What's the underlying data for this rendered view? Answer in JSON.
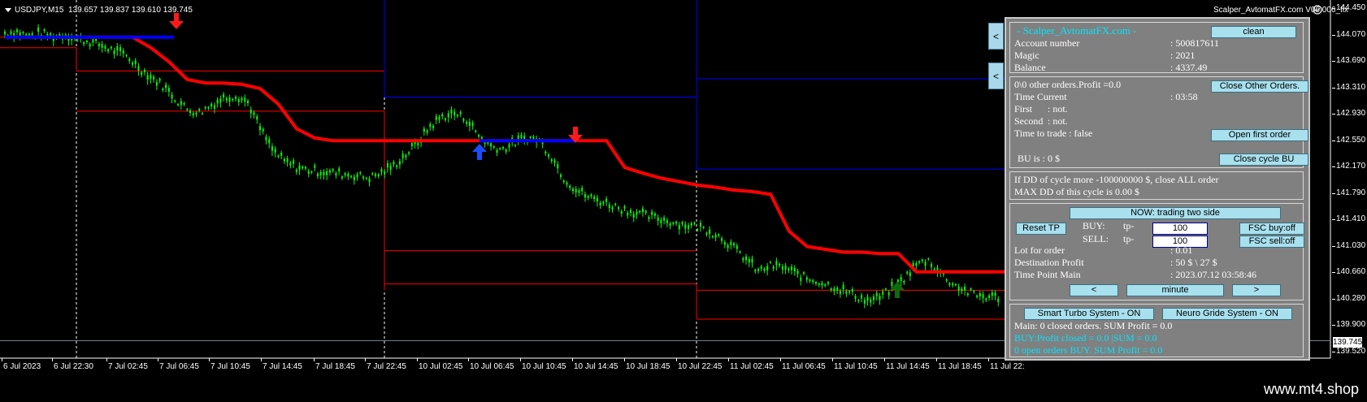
{
  "header": {
    "symbol": "USDJPY,M15",
    "ohlc": "139.657 139.837 139.610 139.745"
  },
  "ea_title": "Scalper_AvtomatFX.com V06.006_fix",
  "price_axis": {
    "labels": [
      "144.450",
      "144.070",
      "143.690",
      "143.310",
      "142.930",
      "142.550",
      "142.170",
      "141.790",
      "141.410",
      "141.030",
      "140.660",
      "140.280",
      "139.900",
      "139.520"
    ],
    "current": "139.745"
  },
  "time_axis": [
    "6 Jul 2023",
    "6 Jul 22:30",
    "7 Jul 02:45",
    "7 Jul 06:45",
    "7 Jul 10:45",
    "7 Jul 14:45",
    "7 Jul 18:45",
    "7 Jul 22:45",
    "10 Jul 02:45",
    "10 Jul 06:45",
    "10 Jul 10:45",
    "10 Jul 14:45",
    "10 Jul 18:45",
    "10 Jul 22:45",
    "11 Jul 02:45",
    "11 Jul 06:45",
    "11 Jul 10:45",
    "11 Jul 14:45",
    "11 Jul 18:45",
    "11 Jul 22:"
  ],
  "chart_data": {
    "type": "candlestick",
    "symbol": "USDJPY",
    "timeframe": "M15",
    "ylim": [
      139.4,
      144.5
    ],
    "price_series": [
      144.1,
      144.12,
      144.06,
      144.1,
      144.05,
      144.08,
      144.02,
      143.98,
      143.92,
      143.85,
      143.78,
      143.62,
      143.48,
      143.36,
      143.18,
      143.02,
      142.98,
      143.08,
      143.18,
      143.22,
      143.12,
      142.75,
      142.45,
      142.28,
      142.2,
      142.16,
      142.14,
      142.12,
      142.1,
      142.08,
      142.05,
      142.12,
      142.22,
      142.38,
      142.55,
      142.78,
      142.92,
      142.96,
      142.88,
      142.65,
      142.5,
      142.46,
      142.55,
      142.62,
      142.58,
      142.35,
      142.05,
      141.88,
      141.78,
      141.72,
      141.66,
      141.6,
      141.55,
      141.5,
      141.46,
      141.42,
      141.38,
      141.36,
      141.3,
      141.2,
      141.05,
      140.9,
      140.72,
      140.8,
      140.78,
      140.7,
      140.62,
      140.58,
      140.52,
      140.45,
      140.38,
      140.3,
      140.35,
      140.48,
      140.62,
      140.82,
      140.88,
      140.7,
      140.55,
      140.45,
      140.38,
      140.36,
      140.35
    ],
    "trailing_stop": [
      144.05,
      144.05,
      144.05,
      144.05,
      144.05,
      144.05,
      144.05,
      144.05,
      143.9,
      143.7,
      143.45,
      143.4,
      143.4,
      143.38,
      143.32,
      143.1,
      142.75,
      142.62,
      142.58,
      142.58,
      142.58,
      142.58,
      142.58,
      142.58,
      142.58,
      142.58,
      142.58,
      142.58,
      142.58,
      142.58,
      142.58,
      142.58,
      142.58,
      142.58,
      142.2,
      142.12,
      142.05,
      142.0,
      141.95,
      141.92,
      141.88,
      141.86,
      141.82,
      141.3,
      141.08,
      141.04,
      141.0,
      141.0,
      140.98,
      140.98,
      140.72,
      140.72,
      140.72,
      140.72,
      140.72,
      140.72
    ],
    "buy_line": {
      "level": 144.05
    },
    "buy_line_2": {
      "level": 142.58
    },
    "signals": [
      {
        "type": "sell",
        "price": 144.15
      },
      {
        "type": "buy",
        "price": 142.45
      },
      {
        "type": "sell",
        "price": 142.7
      },
      {
        "type": "buy",
        "price": 140.45
      }
    ],
    "levels_red": [
      144.0,
      143.57,
      142.98,
      141.02,
      140.46,
      140.02
    ],
    "levels_blue": [
      143.2,
      142.18,
      143.46
    ],
    "grid": false
  },
  "side_buttons": [
    "<",
    "<"
  ],
  "panel": {
    "title": "- Scalper_AvtomatFX.com -",
    "clean_btn": "clean",
    "account_rows": [
      {
        "label": "Account number",
        "value": ": 500817611"
      },
      {
        "label": "Magic",
        "value": ": 2021"
      },
      {
        "label": "Balance",
        "value": ": 4337.49"
      }
    ],
    "orders_line": "0\\0 other orders.Profit =0.0",
    "close_other_btn": "Close Other Orders.",
    "time_current_label": "Time Current",
    "time_current_value": ": 03:58",
    "first_label": "First",
    "first_value": ": not.",
    "second_label": "Second",
    "second_value": ": not.",
    "time_to_trade": "Time to trade :  false",
    "open_first_btn": "Open first order",
    "bu_is": "BU is :  0 $",
    "close_bu_btn": "Close cycle BU",
    "dd_line1": "If DD of cycle more -100000000 $, close ALL order",
    "dd_line2": "MAX DD of this cycle is 0.00 $",
    "now_btn": "NOW: trading two side",
    "reset_tp_btn": "Reset TP",
    "buy_label": "BUY:",
    "buy_tp": "tp-",
    "buy_tp_value": "100",
    "sell_label": "SELL:",
    "sell_tp": "tp-",
    "sell_tp_value": "100",
    "fsc_buy_btn": "FSC buy:off",
    "fsc_sell_btn": "FSC sell:off",
    "lot_label": "Lot for order",
    "lot_value": ": 0.01",
    "dest_label": "Destination Profit",
    "dest_value": ": 50 $ \\ 27 $",
    "tpm_label": "Time Point Main",
    "tpm_value": ": 2023.07.12 03:58:46",
    "prev_btn": "<",
    "tf_btn": "minute",
    "next_btn": ">",
    "turbo_btn": "Smart Turbo System - ON",
    "neuro_btn": "Neuro Gride System - ON",
    "main_line": "Main: 0 closed orders. SUM Profit = 0.0",
    "buy_profit_line": "BUY:Profit closed = 0.0  |SUM = 0.0",
    "open_buy_line": "0 open orders BUY. SUM Profit = 0.0"
  },
  "brand": "www.mt4.shop",
  "colors": {
    "candle": "#00ff00",
    "trail": "#ff0000",
    "buy": "#0000ff",
    "level_red": "#ff0000",
    "level_blue": "#0000ff",
    "panel_bg": "#808080",
    "accent": "#00e5ff"
  }
}
